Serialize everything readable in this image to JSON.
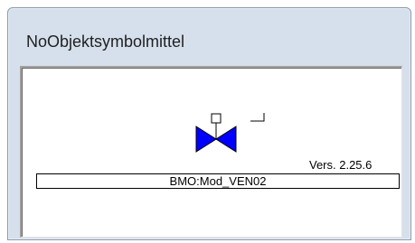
{
  "window": {
    "title": "NoObjektsymbolmittel"
  },
  "symbol": {
    "icon": "valve-icon",
    "version": "Vers. 2.25.6",
    "name": "BMO:Mod_VEN02",
    "colors": {
      "valve_fill": "#0000ff",
      "outline": "#000000"
    }
  }
}
